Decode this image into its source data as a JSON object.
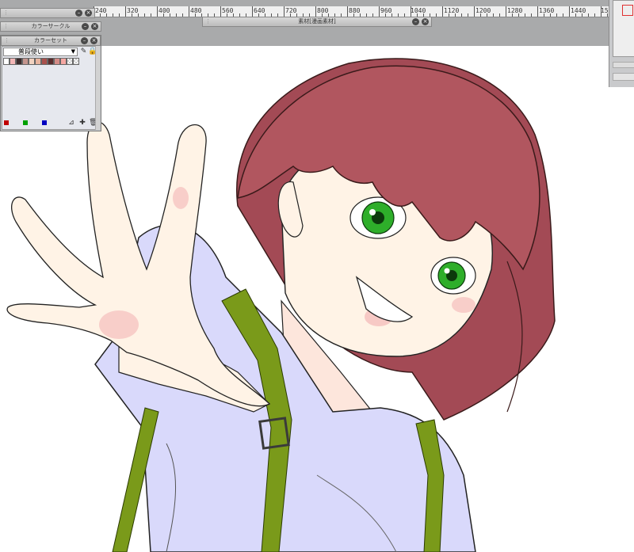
{
  "ruler": {
    "labels": [
      "240",
      "320",
      "400",
      "480",
      "560",
      "640",
      "720",
      "800",
      "880",
      "960",
      "1040",
      "1120",
      "1200",
      "1280",
      "1360",
      "1440",
      "15"
    ]
  },
  "panels": {
    "top_mini": {
      "title": ""
    },
    "color_circle": {
      "title": "カラーサークル"
    },
    "color_set": {
      "title": "カラーセット"
    },
    "material": {
      "title": "素材[漫画素材]"
    }
  },
  "color_set": {
    "selected_set": "普段使い",
    "swatch_colors": [
      "#ffffff",
      "#f3b6b6",
      "#3b2b2b",
      "#c4958e",
      "#f1d2c0",
      "#e7b49f",
      "#a9504c",
      "#5a2d2d",
      "#d48b86",
      "#f5a7a2",
      "#ffffff",
      "#ffffff"
    ],
    "footer_colors": {
      "red": "#c00000",
      "green": "#00a000",
      "blue": "#0000c0"
    },
    "icons": [
      "swatch-settings-icon",
      "lock-icon",
      "eyedropper-add-icon",
      "pen-add-icon",
      "trash-icon"
    ]
  },
  "colors": {
    "workspace": "#a9aaab",
    "hair": "#b1565f",
    "shirt": "#d9d9fb",
    "suspenders": "#7a9a1a",
    "skin": "#fff3e6",
    "eyes": "#2eae2a"
  }
}
